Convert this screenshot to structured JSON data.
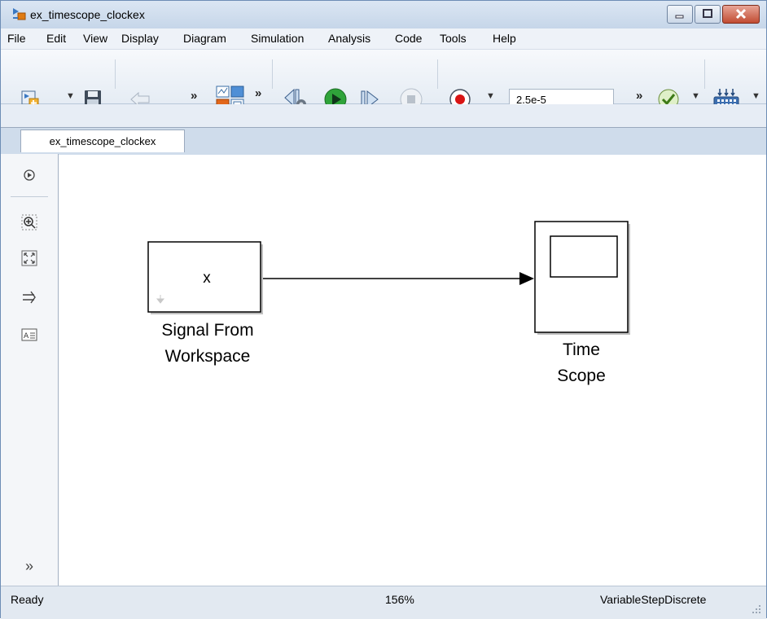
{
  "window": {
    "title": "ex_timescope_clockex"
  },
  "menu": [
    "File",
    "Edit",
    "View",
    "Display",
    "Diagram",
    "Simulation",
    "Analysis",
    "Code",
    "Tools",
    "Help"
  ],
  "toolbar": {
    "stop_time": "2.5e-5",
    "more_symbol": "»"
  },
  "tab": {
    "label": "ex_timescope_clockex"
  },
  "blocks": {
    "source": {
      "symbol": "x",
      "label_line1": "Signal From",
      "label_line2": "Workspace"
    },
    "scope": {
      "label_line1": "Time",
      "label_line2": "Scope"
    }
  },
  "status": {
    "state": "Ready",
    "zoom": "156%",
    "solver": "VariableStepDiscrete"
  },
  "colors": {
    "run_green": "#2fa33a",
    "record_red": "#d81414",
    "titlebar": "#cfdceb",
    "close_red": "#c14c32"
  }
}
